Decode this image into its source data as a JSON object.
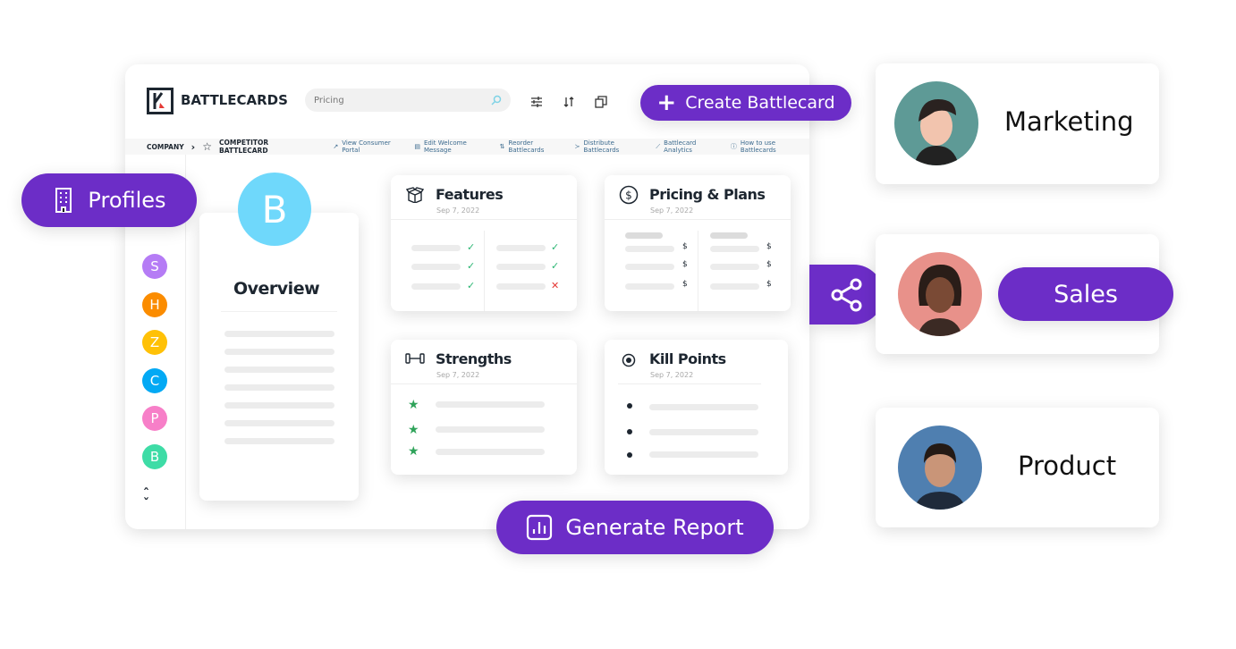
{
  "app": {
    "title": "BATTLECARDS",
    "search_value": "Pricing",
    "create_label": "Create Battlecard"
  },
  "breadcrumb": {
    "company": "COMPANY",
    "current": "COMPETITOR BATTLECARD"
  },
  "links": [
    "View Consumer Portal",
    "Edit Welcome Message",
    "Reorder Battlecards",
    "Distribute Battlecards",
    "Battlecard Analytics",
    "How to use Battlecards"
  ],
  "sidebar": {
    "letters": [
      {
        "l": "S",
        "c": "#b57cf5"
      },
      {
        "l": "H",
        "c": "#fb8c00"
      },
      {
        "l": "Z",
        "c": "#ffc107"
      },
      {
        "l": "C",
        "c": "#03a9f4"
      },
      {
        "l": "P",
        "c": "#f77fc8"
      },
      {
        "l": "B",
        "c": "#3edca6"
      }
    ]
  },
  "profiles_label": "Profiles",
  "overview": {
    "letter": "B",
    "letter_color": "#6fd8fb",
    "title": "Overview"
  },
  "cards": {
    "features": {
      "title": "Features",
      "date": "Sep 7, 2022"
    },
    "pricing": {
      "title": "Pricing & Plans",
      "date": "Sep 7, 2022",
      "symbol": "$"
    },
    "strengths": {
      "title": "Strengths",
      "date": "Sep 7, 2022"
    },
    "kill": {
      "title": "Kill Points",
      "date": "Sep 7, 2022"
    }
  },
  "generate_label": "Generate Report",
  "people": {
    "marketing": "Marketing",
    "sales": "Sales",
    "product": "Product"
  },
  "colors": {
    "accent": "#6c2dc7",
    "check": "#2bb673",
    "cross": "#e53935",
    "star": "#2fa35a"
  }
}
